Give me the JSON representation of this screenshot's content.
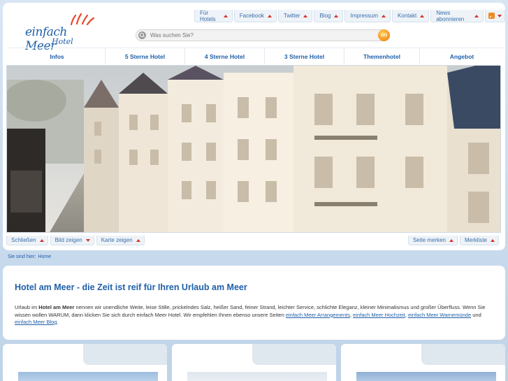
{
  "logo": {
    "title": "einfach Meer",
    "subtitle": "Hotel"
  },
  "top_links": [
    {
      "label": "Für Hotels",
      "arrow": "up"
    },
    {
      "label": "Facebook",
      "arrow": "up"
    },
    {
      "label": "Twitter",
      "arrow": "up"
    },
    {
      "label": "Blog",
      "arrow": "up"
    },
    {
      "label": "Impressum",
      "arrow": "up"
    },
    {
      "label": "Kontakt",
      "arrow": "up"
    },
    {
      "label": "News abonnieren",
      "arrow": "up"
    }
  ],
  "search": {
    "placeholder": "Was suchen Sie?",
    "go_label": "GO"
  },
  "main_nav": [
    "Infos",
    "5 Sterne Hotel",
    "4 Sterne Hotel",
    "3 Sterne Hotel",
    "Themenhotel",
    "Angebot"
  ],
  "hero_controls": {
    "close": "Schließen",
    "show_image": "Bild zeigen",
    "show_map": "Karte zeigen",
    "bookmark": "Seite merken",
    "watchlist": "Merkliste"
  },
  "breadcrumb": {
    "prefix": "Sie sind hier:",
    "home": "Home"
  },
  "content": {
    "title": "Hotel am Meer - die Zeit ist reif für Ihren Urlaub am Meer",
    "p1_start": "Urlaub im ",
    "p1_bold": "Hotel am Meer",
    "p1_rest": " nennen wir unendliche Weite, leise Stille, prickelndes Salz, heißer Sand, feiner Strand, leichter Service, schlichte Eleganz, kleiner Minimalismus und großer Überfluss. Wenn Sie wissen wollen WARUM, dann klicken Sie sich durch einfach Meer Hotel. Wir empfehlen Ihnen ebenso unsere Seiten ",
    "link1": "einfach Meer Arrangements",
    "sep1": ", ",
    "link2": "einfach Meer Hochzeit",
    "sep2": ", ",
    "link3": "einfach Meer Warnemünde",
    "sep3": " und ",
    "link4": "einfach Meer Blog",
    "end": "."
  },
  "colors": {
    "brand_blue": "#1f5fa8",
    "accent_red": "#d9312b",
    "go_orange": "#f07a12"
  }
}
